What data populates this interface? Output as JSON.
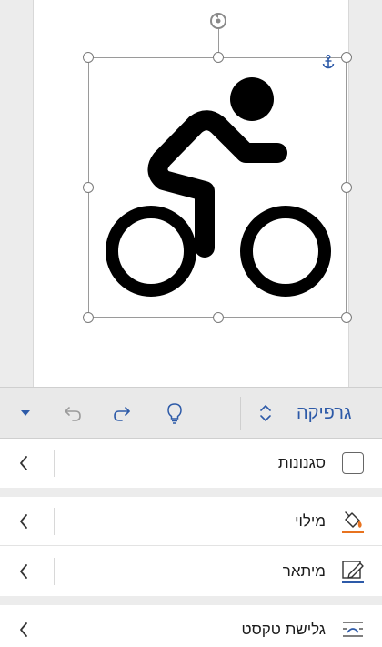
{
  "toolbar": {
    "title": "גרפיקה",
    "icons": [
      "expand-collapse-icon",
      "lightbulb-icon",
      "redo-icon",
      "undo-icon",
      "dropdown-arrow-icon"
    ]
  },
  "list": {
    "items": [
      {
        "label": "סגנונות",
        "icon": "checkbox"
      },
      {
        "label": "מילוי",
        "icon": "fill-bucket-icon"
      },
      {
        "label": "מיתאר",
        "icon": "pencil-outline-icon"
      },
      {
        "label": "גלישת טקסט",
        "icon": "text-wrap-icon"
      }
    ]
  },
  "colors": {
    "accent": "#2d5aa8",
    "fill_underline": "#e8731f",
    "outline_underline": "#2d5aa8"
  }
}
